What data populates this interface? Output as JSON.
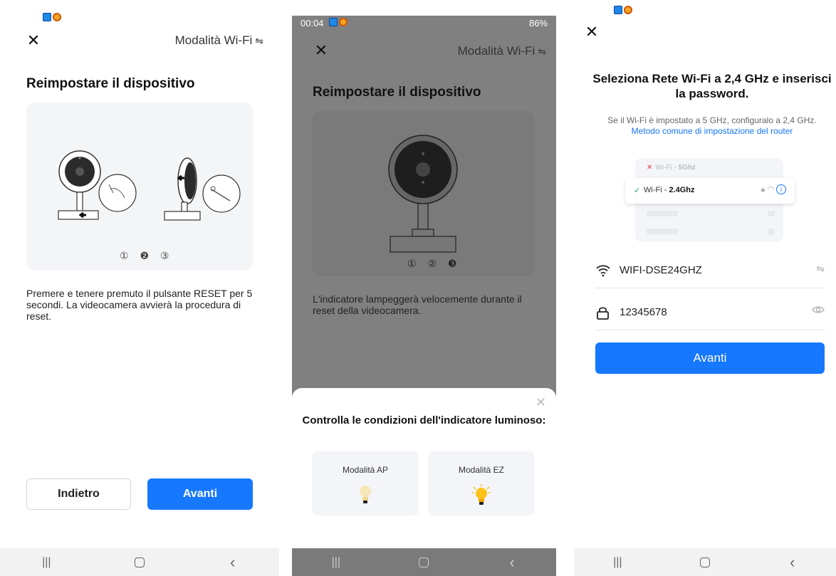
{
  "screen1": {
    "mode_link": "Modalità Wi-Fi",
    "swap_glyph": "⇋",
    "close_glyph": "✕",
    "title": "Reimpostare il dispositivo",
    "steps": "① ❷ ③",
    "description": "Premere e tenere premuto il pulsante RESET per 5 secondi. La videocamera avvierà la procedura di reset.",
    "back_button": "Indietro",
    "next_button": "Avanti",
    "nav": {
      "recent": "|||",
      "back": "‹"
    }
  },
  "screen2": {
    "status_time": "00:04",
    "status_right": "86%",
    "mode_link": "Modalità Wi-Fi",
    "swap_glyph": "⇋",
    "close_glyph": "✕",
    "title": "Reimpostare il dispositivo",
    "steps": "① ② ❸",
    "description": "L'indicatore lampeggerà velocemente durante il reset della videocamera.",
    "sheet": {
      "close_glyph": "✕",
      "title": "Controlla le condizioni dell'indicatore luminoso:",
      "option_ap": "Modalità AP",
      "option_ez": "Modalità EZ"
    },
    "nav": {
      "recent": "|||",
      "back": "‹"
    }
  },
  "screen3": {
    "close_glyph": "✕",
    "title": "Seleziona Rete Wi-Fi a 2,4 GHz e inserisci la password.",
    "note": "Se il Wi-Fi è impostato a 5 GHz, configuralo a 2,4 GHz.",
    "router_link": "Metodo comune di impostazione del router",
    "wifi_5g_prefix": "Wi-Fi - ",
    "wifi_5g_band": "5Ghz",
    "wifi_24_prefix": "Wi-Fi - ",
    "wifi_24_band": "2.4Ghz",
    "ssid": "WIFI-DSE24GHZ",
    "password": "12345678",
    "next_button": "Avanti",
    "nav": {
      "recent": "|||",
      "back": "‹"
    }
  },
  "colors": {
    "accent": "#1677ff",
    "overlay": "#808080",
    "card": "#f4f5f7"
  }
}
